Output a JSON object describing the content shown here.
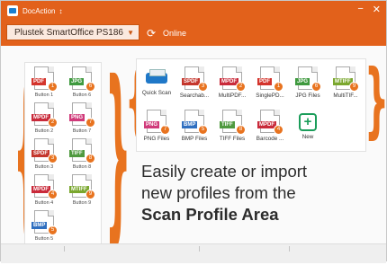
{
  "titlebar": {
    "app_name": "DocAction",
    "menu_glyph": "↕",
    "minimize": "−",
    "close": "✕"
  },
  "scanbar": {
    "scanner": "Plustek SmartOffice PS186",
    "status": "Online"
  },
  "colors": {
    "accent": "#e2611b",
    "pdf": "#d4342c",
    "jpg": "#3f9a3f",
    "mpdf": "#c92a3a",
    "png": "#d03a7a",
    "spdf": "#c4362c",
    "tiff": "#4f9a3f",
    "mtiff": "#7aa72e",
    "bmp": "#2f6fc0"
  },
  "left_buttons": [
    {
      "fmt": "PDF",
      "num": "1",
      "label": "Button 1",
      "color": "#d4342c"
    },
    {
      "fmt": "JPG",
      "num": "6",
      "label": "Button 6",
      "color": "#3f9a3f"
    },
    {
      "fmt": "MPDF",
      "num": "2",
      "label": "Button 2",
      "color": "#c92a3a"
    },
    {
      "fmt": "PNG",
      "num": "7",
      "label": "Button 7",
      "color": "#d03a7a"
    },
    {
      "fmt": "SPDF",
      "num": "3",
      "label": "Button 3",
      "color": "#c4362c"
    },
    {
      "fmt": "TIFF",
      "num": "8",
      "label": "Button 8",
      "color": "#4f9a3f"
    },
    {
      "fmt": "MPDF",
      "num": "4",
      "label": "Button 4",
      "color": "#c92a3a"
    },
    {
      "fmt": "MTIFF",
      "num": "9",
      "label": "Button 9",
      "color": "#7aa72e"
    },
    {
      "fmt": "BMP",
      "num": "5",
      "label": "Button 5",
      "color": "#2f6fc0"
    }
  ],
  "profiles": [
    {
      "type": "scan",
      "label": "Quick Scan"
    },
    {
      "fmt": "SPDF",
      "num": "3",
      "label": "Searchab...",
      "color": "#c4362c"
    },
    {
      "fmt": "MPDF",
      "num": "2",
      "label": "MultiPDF...",
      "color": "#c92a3a"
    },
    {
      "fmt": "PDF",
      "num": "1",
      "label": "SinglePD...",
      "color": "#d4342c"
    },
    {
      "fmt": "JPG",
      "num": "6",
      "label": "JPG Files",
      "color": "#3f9a3f"
    },
    {
      "fmt": "MTIFF",
      "num": "9",
      "label": "MultiTIF...",
      "color": "#7aa72e"
    },
    {
      "fmt": "PNG",
      "num": "7",
      "label": "PNG Files",
      "color": "#d03a7a"
    },
    {
      "fmt": "BMP",
      "num": "5",
      "label": "BMP Files",
      "color": "#2f6fc0"
    },
    {
      "fmt": "TIFF",
      "num": "8",
      "label": "TIFF Files",
      "color": "#4f9a3f"
    },
    {
      "fmt": "MPDF",
      "num": "4",
      "label": "Barcode ...",
      "color": "#c92a3a"
    },
    {
      "type": "new",
      "label": "New"
    }
  ],
  "tagline": {
    "line1": "Easily create or import",
    "line2": "new profiles from the",
    "line3": "Scan Profile Area"
  }
}
